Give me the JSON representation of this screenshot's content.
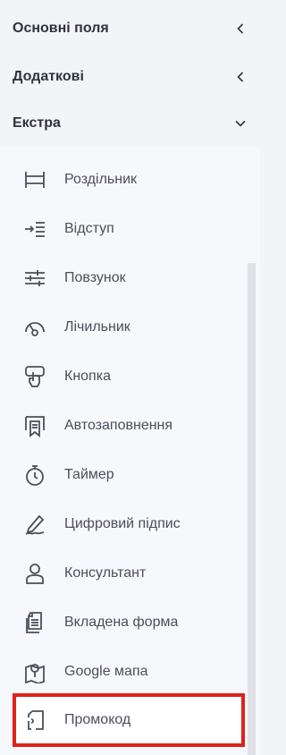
{
  "sections": [
    {
      "label": "Основні поля",
      "state": "collapsed",
      "icon": "chevron-left-icon"
    },
    {
      "label": "Додаткові",
      "state": "collapsed",
      "icon": "chevron-left-icon"
    },
    {
      "label": "Екстра",
      "state": "expanded",
      "icon": "chevron-down-icon"
    }
  ],
  "extra_items": [
    {
      "label": "Роздільник",
      "icon": "divider-icon"
    },
    {
      "label": "Відступ",
      "icon": "indent-icon"
    },
    {
      "label": "Повзунок",
      "icon": "slider-icon"
    },
    {
      "label": "Лічильник",
      "icon": "gauge-icon"
    },
    {
      "label": "Кнопка",
      "icon": "hand-pointer-icon"
    },
    {
      "label": "Автозаповнення",
      "icon": "autofill-icon"
    },
    {
      "label": "Таймер",
      "icon": "stopwatch-icon"
    },
    {
      "label": "Цифровий підпис",
      "icon": "signature-icon"
    },
    {
      "label": "Консультант",
      "icon": "user-icon"
    },
    {
      "label": "Вкладена форма",
      "icon": "nested-form-icon"
    },
    {
      "label": "Google мапа",
      "icon": "map-icon"
    },
    {
      "label": "Промокод",
      "icon": "promo-code-icon"
    }
  ],
  "colors": {
    "highlight_border": "#e0201b",
    "icon": "#4a4f5a"
  }
}
